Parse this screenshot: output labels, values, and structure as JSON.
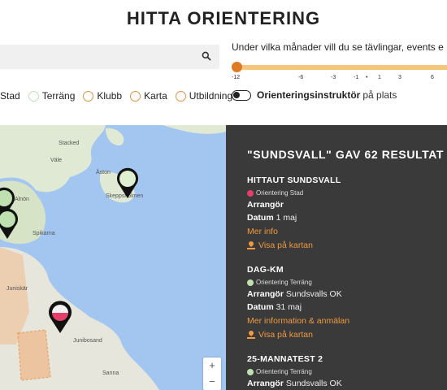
{
  "page": {
    "title": "HITTA ORIENTERING"
  },
  "search": {
    "value": "",
    "placeholder": ""
  },
  "filters": [
    {
      "label": "Stad",
      "color": "#bfe0b1"
    },
    {
      "label": "Terräng",
      "color": "#bfe0b1"
    },
    {
      "label": "Klubb",
      "color": "#e2913e"
    },
    {
      "label": "Karta",
      "color": "#e2913e"
    },
    {
      "label": "Utbildning",
      "color": "#e2913e"
    }
  ],
  "month_filter": {
    "question": "Under vilka månader vill du se tävlingar, events e",
    "ticks": [
      "-12",
      "-6",
      "-3",
      "-1",
      "•",
      "1",
      "3",
      "6"
    ],
    "accent": "#e07a22"
  },
  "instructor_toggle": {
    "label": "Orienteringsinstruktör",
    "suffix": "på plats",
    "on": false
  },
  "map": {
    "places": [
      "Stacked",
      "Väle",
      "Åston",
      "Skeppsholmen",
      "Alnön",
      "Spikarna",
      "Juniskär",
      "Junibosand",
      "Sanna"
    ],
    "zoom_in": "+",
    "zoom_out": "−"
  },
  "results": {
    "title": "\"SUNDSVALL\" GAV 62 RESULTAT",
    "events": [
      {
        "name": "HITTAUT SUNDSVALL",
        "type": "Orientering Stad",
        "type_color": "#e23f6a",
        "arranger_label": "Arrangör",
        "arranger": "",
        "date_label": "Datum",
        "date": "1 maj",
        "info_link": "Mer info",
        "map_link": "Visa på kartan"
      },
      {
        "name": "DAG-KM",
        "type": "Orientering Terräng",
        "type_color": "#bfe0b1",
        "arranger_label": "Arrangör",
        "arranger": "Sundsvalls OK",
        "date_label": "Datum",
        "date": "31 maj",
        "info_link": "Mer information & anmälan",
        "map_link": "Visa på kartan"
      },
      {
        "name": "25-MANNATEST 2",
        "type": "Orientering Terräng",
        "type_color": "#bfe0b1",
        "arranger_label": "Arrangör",
        "arranger": "Sundsvalls OK"
      }
    ]
  }
}
